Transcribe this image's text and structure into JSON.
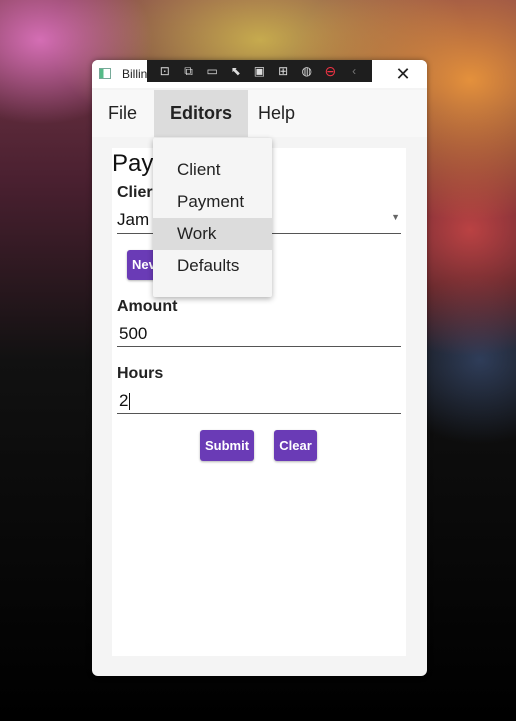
{
  "window": {
    "title": "Billing"
  },
  "debug_toolbar": {
    "icons": [
      "select-element-icon",
      "preview-icon",
      "video-icon",
      "pointer-icon",
      "frame-icon",
      "display-layout-icon",
      "track-focus-icon",
      "stop-icon",
      "collapse-icon"
    ]
  },
  "menu": {
    "file": "File",
    "editors": "Editors",
    "help": "Help"
  },
  "editors_menu": {
    "items": [
      "Client",
      "Payment",
      "Work",
      "Defaults"
    ],
    "highlighted": "Work"
  },
  "form": {
    "title_visible": "Pay",
    "client_label_visible": "Clier",
    "client_value_visible": "Jam",
    "new_button_visible": "Nev",
    "amount_label": "Amount",
    "amount_value": "500",
    "hours_label": "Hours",
    "hours_value": "2",
    "submit_label": "Submit",
    "clear_label": "Clear"
  },
  "colors": {
    "accent": "#6a3bb6",
    "menu_highlight": "#dcdcdc"
  }
}
